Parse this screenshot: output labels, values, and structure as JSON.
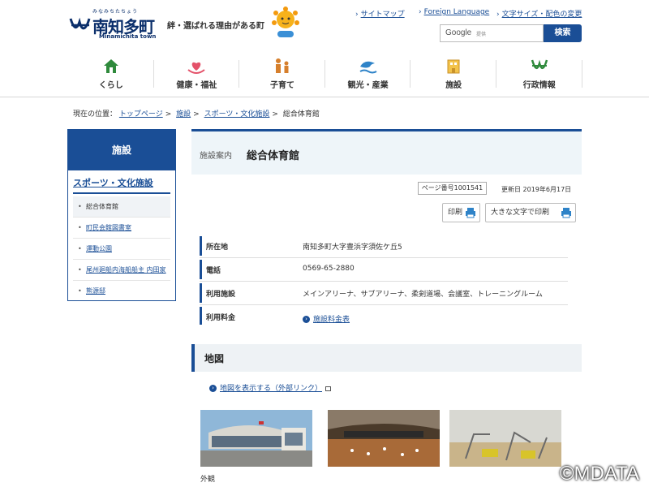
{
  "header": {
    "logo_ruby": "みなみちたちょう",
    "logo_name": "南知多町",
    "logo_en": "Minamichita town",
    "tagline": "絆・選ばれる理由がある町",
    "util_links": [
      "サイトマップ",
      "Foreign Language",
      "文字サイズ・配色の変更"
    ],
    "search_google": "Google",
    "search_powered": "提供",
    "search_button": "検索"
  },
  "gnav": [
    {
      "label": "くらし",
      "icon": "house-icon"
    },
    {
      "label": "健康・福祉",
      "icon": "heart-hands-icon"
    },
    {
      "label": "子育て",
      "icon": "family-icon"
    },
    {
      "label": "観光・産業",
      "icon": "dolphin-icon"
    },
    {
      "label": "施設",
      "icon": "building-icon"
    },
    {
      "label": "行政情報",
      "icon": "town-mark-icon"
    }
  ],
  "breadcrumb": {
    "prefix": "現在の位置：",
    "items": [
      "トップページ",
      "施設",
      "スポーツ・文化施設",
      "総合体育館"
    ]
  },
  "sidebar": {
    "heading": "施設",
    "category": "スポーツ・文化施設",
    "items": [
      "総合体育館",
      "町民会館図書室",
      "運動公園",
      "尾州廻船内海船船主 内田家",
      "熊源邸"
    ]
  },
  "main": {
    "title_prefix": "施設案内",
    "title": "総合体育館",
    "page_number": "ページ番号1001541",
    "updated": "更新日 2019年6月17日",
    "print_label": "印刷",
    "print_large_label": "大きな文字で印刷",
    "info": [
      {
        "label": "所在地",
        "value": "南知多町大字豊浜字須佐ケ丘5"
      },
      {
        "label": "電話",
        "value": "0569-65-2880"
      },
      {
        "label": "利用施設",
        "value": "メインアリーナ、サブアリーナ、柔剣道場、会議室、トレーニングルーム"
      },
      {
        "label": "利用料金",
        "value": "施設料金表"
      }
    ],
    "map_heading": "地図",
    "map_link": "地図を表示する（外部リンク）",
    "photo_caption": "外観"
  },
  "watermark": "©MDATA",
  "colors": {
    "brand": "#1a4e96",
    "title_bg": "#eef5f9"
  }
}
